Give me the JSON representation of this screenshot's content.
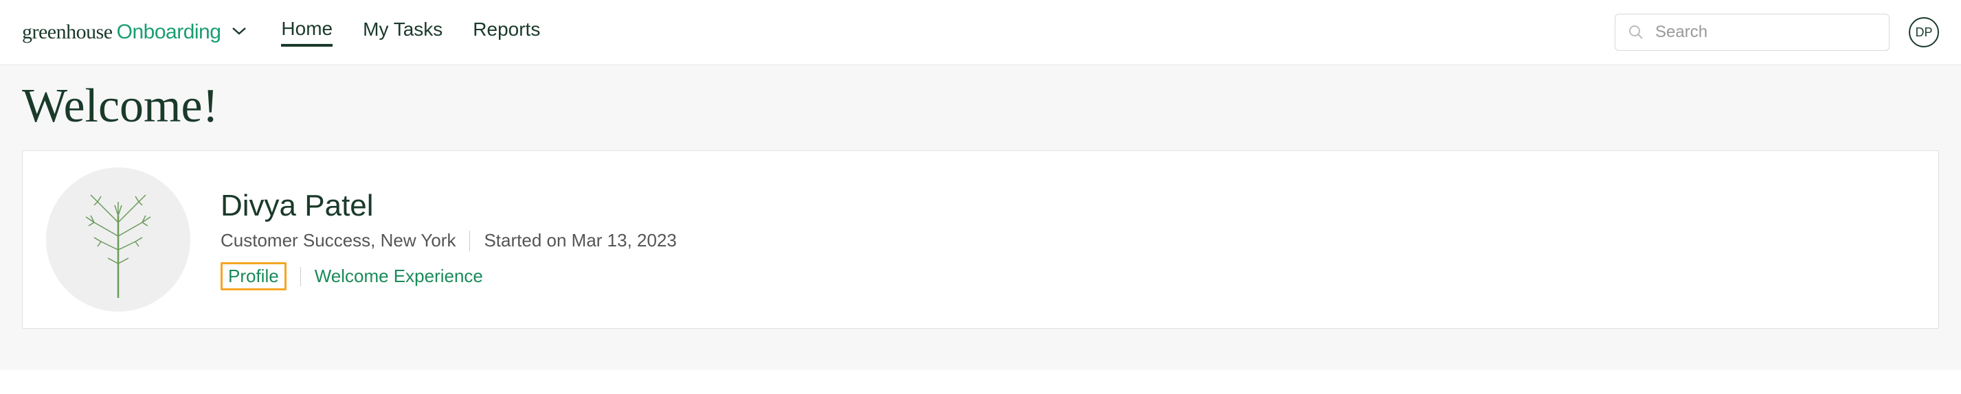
{
  "brand": {
    "primary": "greenhouse",
    "secondary": "Onboarding"
  },
  "nav": {
    "tabs": [
      {
        "label": "Home",
        "active": true
      },
      {
        "label": "My Tasks",
        "active": false
      },
      {
        "label": "Reports",
        "active": false
      }
    ]
  },
  "search": {
    "placeholder": "Search"
  },
  "user": {
    "initials": "DP"
  },
  "main": {
    "welcome_heading": "Welcome!",
    "profile": {
      "name": "Divya Patel",
      "role_location": "Customer Success, New York",
      "start_date": "Started on Mar 13, 2023",
      "links": {
        "profile": "Profile",
        "welcome_experience": "Welcome Experience"
      }
    }
  }
}
